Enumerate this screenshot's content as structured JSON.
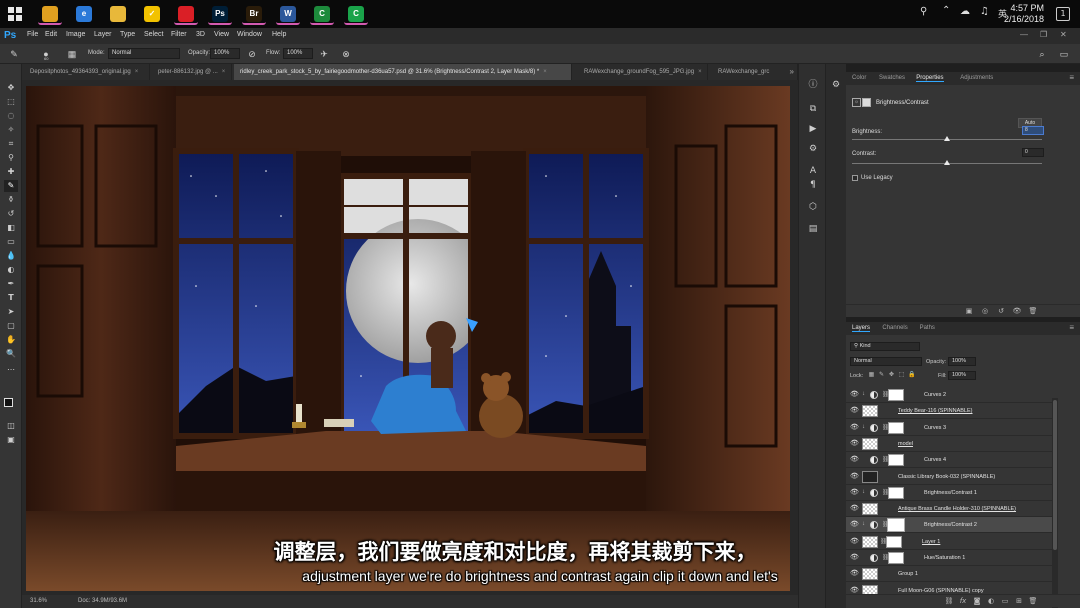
{
  "taskbar": {
    "apps": [
      {
        "name": "chrome-icon",
        "color": "#e0a020",
        "glyph": "",
        "active": true
      },
      {
        "name": "edge-icon",
        "color": "#2b79d8",
        "glyph": "e",
        "active": false
      },
      {
        "name": "file-explorer-icon",
        "color": "#e8b83a",
        "glyph": "",
        "active": false
      },
      {
        "name": "norton-icon",
        "color": "#f2c200",
        "glyph": "✓",
        "active": false
      },
      {
        "name": "creative-cloud-icon",
        "color": "#da1f26",
        "glyph": "",
        "active": true
      },
      {
        "name": "photoshop-icon",
        "color": "#001e36",
        "glyph": "Ps",
        "active": true
      },
      {
        "name": "bridge-icon",
        "color": "#2a1c0a",
        "glyph": "Br",
        "active": true
      },
      {
        "name": "word-icon",
        "color": "#2b579a",
        "glyph": "W",
        "active": true
      },
      {
        "name": "camtasia-icon",
        "color": "#1d8a3c",
        "glyph": "C",
        "active": true
      },
      {
        "name": "camtasia-recorder-icon",
        "color": "#1aa34a",
        "glyph": "C",
        "active": true
      }
    ],
    "time": "4:57 PM",
    "date": "2/16/2018",
    "notification_count": "1"
  },
  "menubar": {
    "logo": "Ps",
    "items": [
      "File",
      "Edit",
      "Image",
      "Layer",
      "Type",
      "Select",
      "Filter",
      "3D",
      "View",
      "Window",
      "Help"
    ]
  },
  "options": {
    "mode_label": "Mode:",
    "mode_value": "Normal",
    "opacity_label": "Opacity:",
    "opacity_value": "100%",
    "flow_label": "Flow:",
    "flow_value": "100%",
    "brush_size": "60"
  },
  "tabs": [
    {
      "label": "Depositphotos_49364393_original.jpg",
      "active": false
    },
    {
      "label": "peter-886132.jpg @ ...",
      "active": false
    },
    {
      "label": "ridley_creek_park_stock_5_by_fairiegoodmother-d36ua57.psd @ 31.6% (Brightness/Contrast 2, Layer Mask/8) *",
      "active": true
    },
    {
      "label": "RAWexchange_groundFog_595_JPG.jpg",
      "active": false
    },
    {
      "label": "RAWexchange_grc",
      "active": false
    }
  ],
  "status": {
    "zoom": "31.6%",
    "doc": "Doc: 34.9M/93.6M"
  },
  "subtitles": {
    "chinese": "调整层，我们要做亮度和对比度，再将其裁剪下来，",
    "english": "adjustment layer we're do brightness and contrast again clip it down and let's"
  },
  "panels": {
    "top_tabs": [
      "Color",
      "Swatches",
      "Properties",
      "Adjustments"
    ],
    "active_top_tab": "Properties",
    "properties": {
      "title": "Brightness/Contrast",
      "auto_label": "Auto",
      "brightness_label": "Brightness:",
      "brightness_value": "8",
      "contrast_label": "Contrast:",
      "contrast_value": "0",
      "use_legacy_label": "Use Legacy"
    },
    "layer_tabs": [
      "Layers",
      "Channels",
      "Paths"
    ],
    "active_layer_tab": "Layers",
    "layers_panel": {
      "filter_kind": "Kind",
      "blend_mode": "Normal",
      "opacity_label": "Opacity:",
      "opacity_value": "100%",
      "lock_label": "Lock:",
      "fill_label": "Fill:",
      "fill_value": "100%"
    },
    "layers": [
      {
        "name": "Curves 2",
        "kind": "adjustment",
        "clipped": true,
        "underline": false,
        "selected": false
      },
      {
        "name": "Teddy Bear-116 (SPINNABLE)",
        "kind": "pixel",
        "clipped": false,
        "underline": true,
        "selected": false
      },
      {
        "name": "Curves 3",
        "kind": "adjustment",
        "clipped": true,
        "underline": false,
        "selected": false
      },
      {
        "name": "model",
        "kind": "pixel",
        "clipped": false,
        "underline": true,
        "selected": false
      },
      {
        "name": "Curves 4",
        "kind": "adjustment",
        "clipped": false,
        "underline": false,
        "selected": false
      },
      {
        "name": "Classic Library Book-032 (SPINNABLE)",
        "kind": "pixel",
        "clipped": false,
        "underline": false,
        "selected": false
      },
      {
        "name": "Brightness/Contrast 1",
        "kind": "adjustment",
        "clipped": true,
        "underline": false,
        "selected": false
      },
      {
        "name": "Antique Brass Candle Holder-310 (SPINNABLE)",
        "kind": "pixel",
        "clipped": false,
        "underline": true,
        "selected": false
      },
      {
        "name": "Brightness/Contrast 2",
        "kind": "adjustment",
        "clipped": true,
        "underline": false,
        "selected": true
      },
      {
        "name": "Layer 1",
        "kind": "pixel-mask",
        "clipped": false,
        "underline": true,
        "selected": false
      },
      {
        "name": "Hue/Saturation 1",
        "kind": "adjustment",
        "clipped": false,
        "underline": false,
        "selected": false
      },
      {
        "name": "Group 1",
        "kind": "group",
        "clipped": false,
        "underline": false,
        "selected": false
      },
      {
        "name": "Full Moon-G06 (SPINNABLE) copy",
        "kind": "pixel",
        "clipped": false,
        "underline": false,
        "selected": false
      }
    ]
  },
  "colors": {
    "ps_blue": "#31a8ff",
    "panel_bg": "#353535",
    "selected_layer": "#4a4a4a",
    "night_sky": "#1c2f7a"
  }
}
